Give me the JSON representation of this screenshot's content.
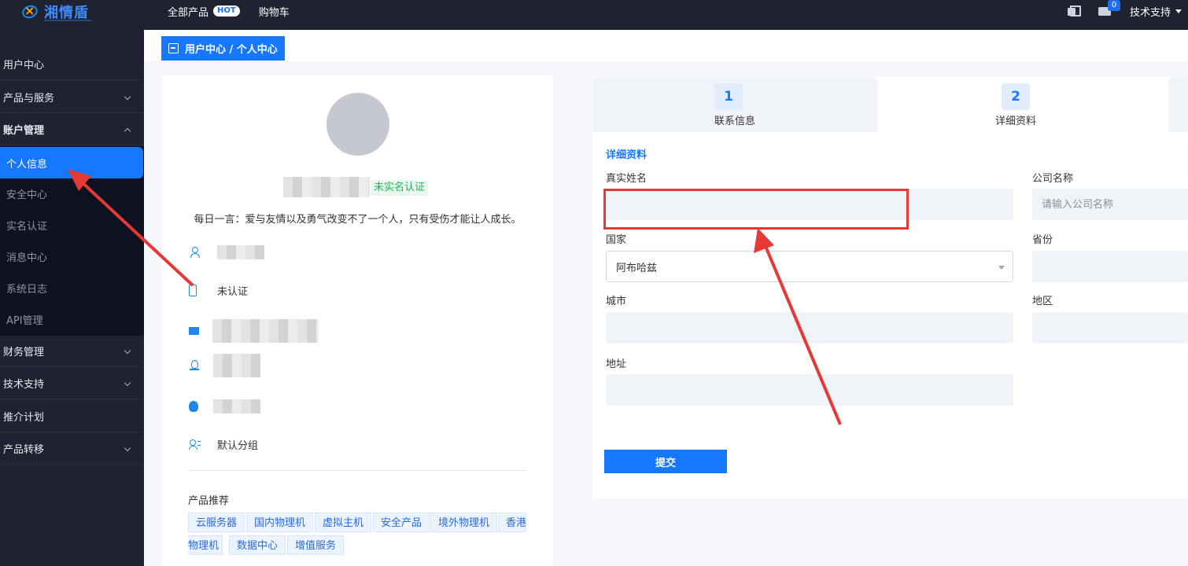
{
  "app": {
    "logo_text": "湘情盾"
  },
  "topnav": {
    "items": [
      {
        "label": "全部产品",
        "badge": "HOT"
      },
      {
        "label": "购物车"
      }
    ],
    "message_count": "0",
    "support_label": "技术支持"
  },
  "sidebar": {
    "items": [
      {
        "label": "用户中心",
        "expandable": false
      },
      {
        "label": "产品与服务",
        "expandable": true
      },
      {
        "label": "账户管理",
        "expandable": true,
        "expanded": true
      },
      {
        "label": "财务管理",
        "expandable": true
      },
      {
        "label": "技术支持",
        "expandable": true
      },
      {
        "label": "推介计划",
        "expandable": false
      },
      {
        "label": "产品转移",
        "expandable": true
      }
    ],
    "subitems": [
      {
        "label": "个人信息",
        "active": true
      },
      {
        "label": "安全中心"
      },
      {
        "label": "实名认证"
      },
      {
        "label": "消息中心"
      },
      {
        "label": "系统日志"
      },
      {
        "label": "API管理"
      }
    ]
  },
  "breadcrumb": {
    "text": "用户中心 / 个人中心"
  },
  "profile": {
    "verify_status": "未实名认证",
    "motto": "每日一言：爱与友情以及勇气改变不了一个人，只有受伤才能让人成长。",
    "phone_status": "未认证",
    "group": "默认分组",
    "recommend_title": "产品推荐",
    "recommend_tags": [
      "云服务器",
      "国内物理机",
      "虚拟主机",
      "安全产品",
      "境外物理机",
      "香港",
      "物理机",
      "数据中心",
      "增值服务"
    ]
  },
  "steps": [
    {
      "num": "1",
      "label": "联系信息"
    },
    {
      "num": "2",
      "label": "详细资料"
    }
  ],
  "form": {
    "section_title": "详细资料",
    "real_name_label": "真实姓名",
    "real_name_value": "",
    "company_label": "公司名称",
    "company_placeholder": "请输入公司名称",
    "country_label": "国家",
    "country_value": "阿布哈兹",
    "province_label": "省份",
    "city_label": "城市",
    "district_label": "地区",
    "address_label": "地址",
    "submit_label": "提交"
  },
  "colors": {
    "primary": "#1677ff",
    "dark_bg": "#1f2230",
    "annotation": "#e53935",
    "verify_green": "#1fb35a"
  }
}
